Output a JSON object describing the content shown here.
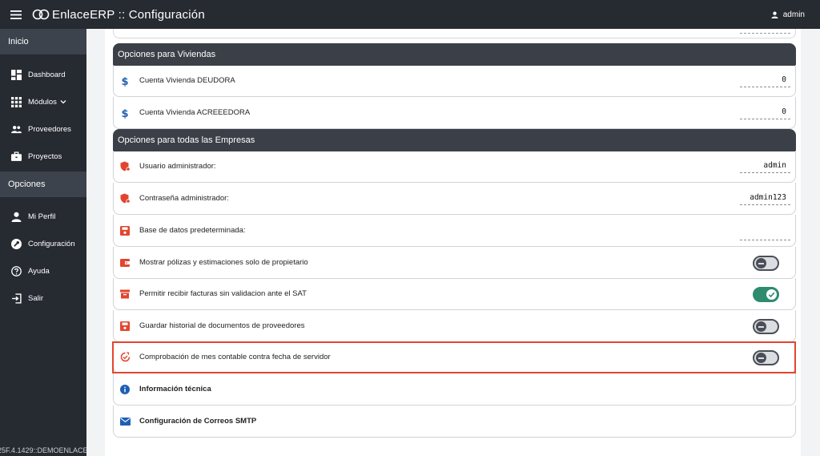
{
  "header": {
    "app_title": "EnlaceERP :: Configuración",
    "user_name": "admin"
  },
  "sidebar": {
    "section_inicio": "Inicio",
    "section_opciones": "Opciones",
    "items": [
      {
        "label": "Dashboard",
        "icon": "dashboard-icon"
      },
      {
        "label": "Módulos",
        "icon": "apps-grid-icon"
      },
      {
        "label": "Proveedores",
        "icon": "people-icon"
      },
      {
        "label": "Proyectos",
        "icon": "briefcase-icon"
      }
    ],
    "options_items": [
      {
        "label": "Mi Perfil",
        "icon": "person-icon"
      },
      {
        "label": "Configuración",
        "icon": "wrench-icon"
      },
      {
        "label": "Ayuda",
        "icon": "help-icon"
      },
      {
        "label": "Salir",
        "icon": "logout-icon"
      }
    ],
    "version": "25F.4.1429::DEMOENLACE"
  },
  "viviendas": {
    "title": "Opciones para Viviendas",
    "rows": [
      {
        "label": "Cuenta Vivienda DEUDORA",
        "value": "0"
      },
      {
        "label": "Cuenta Vivienda ACREEEDORA",
        "value": "0"
      }
    ]
  },
  "empresas": {
    "title": "Opciones para todas las Empresas",
    "rows": [
      {
        "label": "Usuario administrador:",
        "value": "admin"
      },
      {
        "label": "Contraseña administrador:",
        "value": "admin123"
      },
      {
        "label": "Base de datos predeterminada:",
        "value": ""
      },
      {
        "label": "Mostrar pólizas y estimaciones solo de propietario",
        "toggle": false
      },
      {
        "label": "Permitir recibir facturas sin validacion ante el SAT",
        "toggle": true
      },
      {
        "label": "Guardar historial de documentos de proveedores",
        "toggle": false
      },
      {
        "label": "Comprobación de mes contable contra fecha de servidor",
        "toggle": false
      }
    ]
  },
  "extra": {
    "info_label": "Información técnica",
    "smtp_label": "Configuración de Correos SMTP"
  },
  "colors": {
    "dark": "#262a31",
    "accent_red": "#e2452f",
    "toggle_on": "#2e8b6e",
    "info_blue": "#1e5fb4"
  }
}
